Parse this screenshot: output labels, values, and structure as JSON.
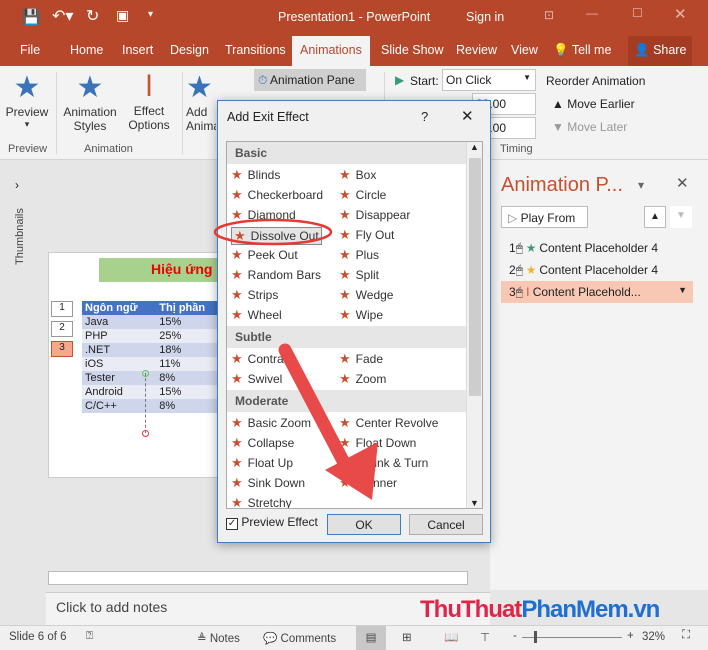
{
  "window": {
    "title": "Presentation1  -  PowerPoint",
    "sign_in": "Sign in"
  },
  "tabs": [
    "File",
    "Home",
    "Insert",
    "Design",
    "Transitions",
    "Animations",
    "Slide Show",
    "Review",
    "View",
    "Tell me",
    "Share"
  ],
  "ribbon": {
    "preview": "Preview",
    "animation_styles": "Animation Styles",
    "effect_options": "Effect Options",
    "add_animation": "Add Animation",
    "animation_pane": "Animation Pane",
    "start_label": "Start:",
    "start_value": "On Click",
    "duration_value": "00.00",
    "delay_value": "00.00",
    "reorder": "Reorder Animation",
    "move_earlier": "Move Earlier",
    "move_later": "Move Later",
    "groups": [
      "Preview",
      "Animation",
      "Timing"
    ]
  },
  "leftbar": {
    "thumbnails": "Thumbnails"
  },
  "slide": {
    "title": "Hiệu ứng",
    "tags": [
      "1",
      "2",
      "3"
    ],
    "table": {
      "headers": [
        "Ngôn ngữ",
        "Thị phần"
      ],
      "rows": [
        [
          "Java",
          "15%"
        ],
        [
          "PHP",
          "25%"
        ],
        [
          ".NET",
          "18%"
        ],
        [
          "iOS",
          "11%"
        ],
        [
          "Tester",
          "8%"
        ],
        [
          "Android",
          "15%"
        ],
        [
          "C/C++",
          "8%"
        ]
      ]
    }
  },
  "pane": {
    "title": "Animation P...",
    "play_from": "Play From",
    "items": [
      {
        "num": "1",
        "label": "Content Placeholder 4",
        "color": "#3a9c7b"
      },
      {
        "num": "2",
        "label": "Content Placeholder 4",
        "color": "#f0b429"
      },
      {
        "num": "3",
        "label": "Content Placehold...",
        "color": "#c7502f"
      }
    ]
  },
  "dialog": {
    "title": "Add Exit Effect",
    "help": "?",
    "sections": [
      {
        "name": "Basic",
        "items": [
          "Blinds",
          "Box",
          "Checkerboard",
          "Circle",
          "Diamond",
          "Disappear",
          "Dissolve Out",
          "Fly Out",
          "Peek Out",
          "Plus",
          "Random Bars",
          "Split",
          "Strips",
          "Wedge",
          "Wheel",
          "Wipe"
        ]
      },
      {
        "name": "Subtle",
        "items": [
          "Contract",
          "Fade",
          "Swivel",
          "Zoom"
        ]
      },
      {
        "name": "Moderate",
        "items": [
          "Basic Zoom",
          "Center Revolve",
          "Collapse",
          "Float Down",
          "Float Up",
          "Shrink & Turn",
          "Sink Down",
          "Spinner",
          "Stretchy"
        ]
      }
    ],
    "selected": "Dissolve Out",
    "preview_effect": "Preview Effect",
    "preview_checked": true,
    "ok": "OK",
    "cancel": "Cancel"
  },
  "notes": {
    "placeholder": "Click to add notes"
  },
  "status": {
    "slide": "Slide 6 of 6",
    "notes": "Notes",
    "comments": "Comments",
    "zoom": "32%"
  },
  "watermark": "ThuThuatPhanMem.vn"
}
